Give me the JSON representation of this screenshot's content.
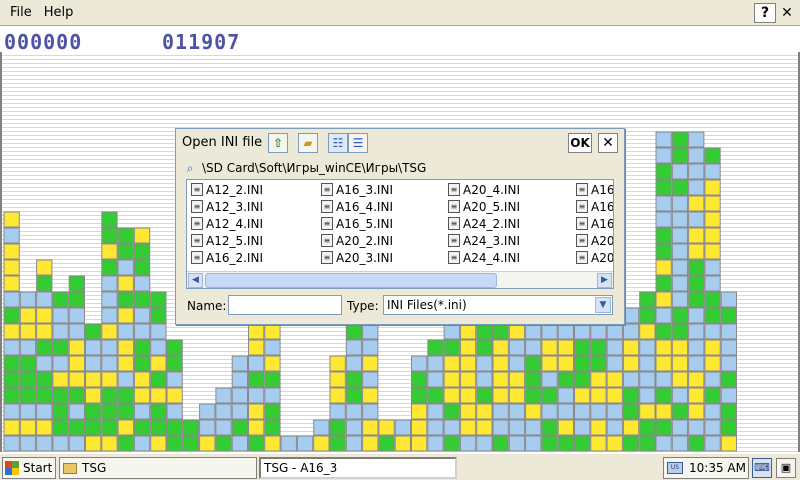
{
  "menu": {
    "file": "File",
    "help": "Help",
    "help_icon": "?",
    "close_icon": "✕"
  },
  "scores": {
    "left": "000000",
    "right": "011907"
  },
  "colors": {
    "green": "#33cc33",
    "blue": "#a6ccf0",
    "yellow": "#ffe832",
    "edge": "#8a8a8a"
  },
  "dialog": {
    "title": "Open INI file",
    "ok": "OK",
    "close": "✕",
    "path": "\\SD Card\\Soft\\Игры_winCE\\Игры\\TSG",
    "files": [
      [
        "A12_2.INI",
        "A12_3.INI",
        "A12_4.INI",
        "A12_5.INI",
        "A16_2.INI"
      ],
      [
        "A16_3.INI",
        "A16_4.INI",
        "A16_5.INI",
        "A20_2.INI",
        "A20_3.INI"
      ],
      [
        "A20_4.INI",
        "A20_5.INI",
        "A24_2.INI",
        "A24_3.INI",
        "A24_4.INI"
      ],
      [
        "A16",
        "A16",
        "A16",
        "A20",
        "A20"
      ]
    ],
    "name_label": "Name:",
    "name_value": "",
    "type_label": "Type:",
    "type_value": "INI Files(*.ini)"
  },
  "taskbar": {
    "start": "Start",
    "folder_task": "TSG",
    "app_task": "TSG - A16_3",
    "clock": "10:35 AM"
  },
  "board": {
    "columns": [
      "bybgggbygbyyyby",
      "bybgggbyyb",
      "bybggbgyybgy",
      "bgggybgbbg",
      "bgbgyyybbgg",
      "yggyybbg",
      "ygggybbybbbgygg",
      "gyggbyybygybgg",
      "bgbyyggbbgbggy",
      "yggygybbgg",
      "ggbybgg",
      "gg",
      "ybb",
      "gbbb",
      "bgbbbb",
      "gyybgbyygygyb",
      "yggbgybyyggby",
      "b",
      "b",
      "yb",
      "ggbyyy",
      "bbbggbbgyg",
      "yybybybbbbgyyby",
      "gy",
      "yb",
      "yyyggb",
      "bbbgbbg",
      "gbgyyygbgbb",
      "byyyyyyygg",
      "byygbbgggbbbygygbbyg",
      "gbbyyyygbbg",
      "bbbyybbyyb",
      "bbygggbbbg",
      "ggbgbyybgb",
      "gybbgyybyb",
      "gbbygggbbgy",
      "yybyyggbgg",
      "ybbyybbbb",
      "gyggbyybb",
      "ggybbbbygg",
      "bgygbyygbygyggbbggbb",
      "bbgbyyyggbbbbbbbgbgg",
      "gbyyybbbbgggyybybbbb",
      "bbbgbyybggbbyyyyybg",
      "yggbgbbbgb"
    ]
  }
}
